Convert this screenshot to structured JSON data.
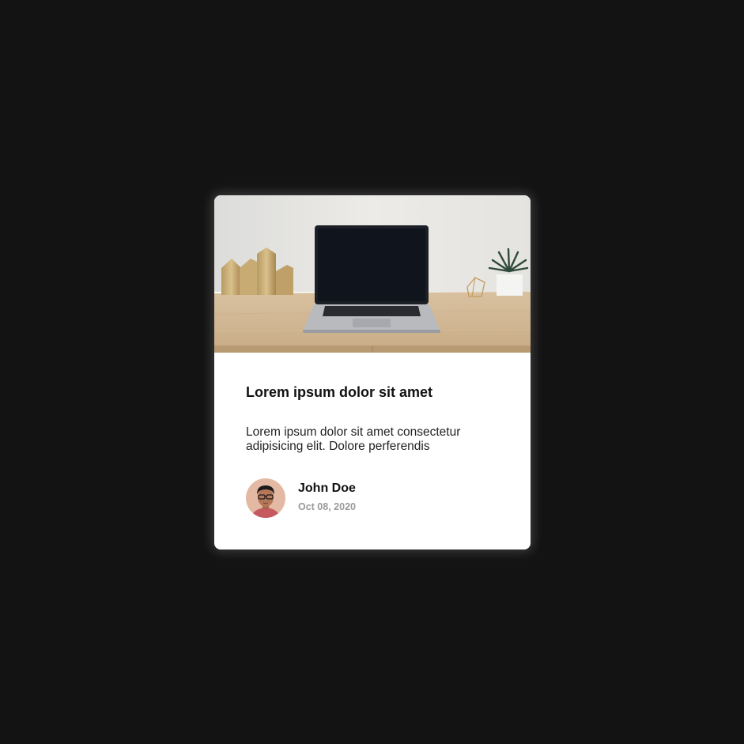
{
  "card": {
    "image_subject": "laptop-on-wooden-desk",
    "title": "Lorem ipsum dolor sit amet",
    "text": "Lorem ipsum dolor sit amet consectetur adipisicing elit. Dolore perferendis",
    "author": {
      "name": "John Doe",
      "date": "Oct 08, 2020",
      "avatar_subject": "man-with-glasses"
    }
  },
  "colors": {
    "page_background": "#131313",
    "card_background": "#ffffff",
    "title_text": "#111111",
    "date_text": "#9a9a9a"
  }
}
